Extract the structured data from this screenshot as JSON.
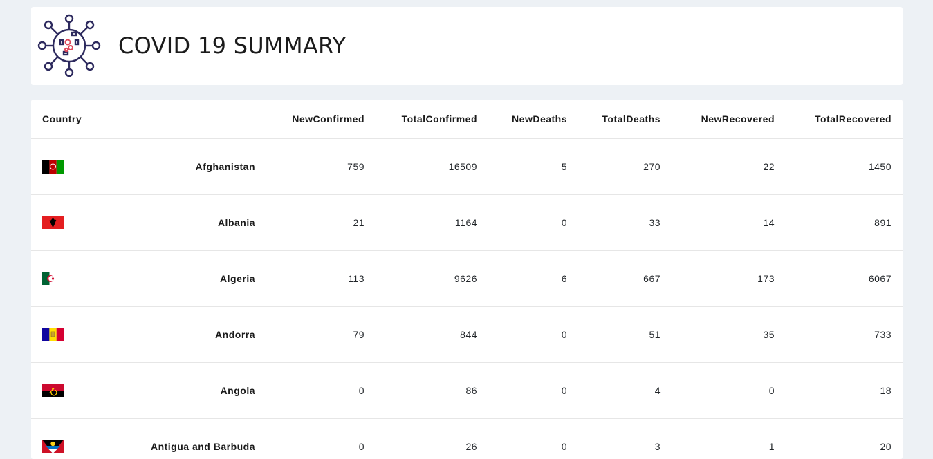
{
  "header": {
    "title": "COVID 19 SUMMARY",
    "logo_icon": "virus-icon",
    "logo_colors": {
      "outline": "#2d2a5e",
      "accent": "#e0485a"
    }
  },
  "table": {
    "columns": [
      "Country",
      "NewConfirmed",
      "TotalConfirmed",
      "NewDeaths",
      "TotalDeaths",
      "NewRecovered",
      "TotalRecovered"
    ],
    "rows": [
      {
        "flag": "afghanistan-flag-icon",
        "country": "Afghanistan",
        "NewConfirmed": "759",
        "TotalConfirmed": "16509",
        "NewDeaths": "5",
        "TotalDeaths": "270",
        "NewRecovered": "22",
        "TotalRecovered": "1450"
      },
      {
        "flag": "albania-flag-icon",
        "country": "Albania",
        "NewConfirmed": "21",
        "TotalConfirmed": "1164",
        "NewDeaths": "0",
        "TotalDeaths": "33",
        "NewRecovered": "14",
        "TotalRecovered": "891"
      },
      {
        "flag": "algeria-flag-icon",
        "country": "Algeria",
        "NewConfirmed": "113",
        "TotalConfirmed": "9626",
        "NewDeaths": "6",
        "TotalDeaths": "667",
        "NewRecovered": "173",
        "TotalRecovered": "6067"
      },
      {
        "flag": "andorra-flag-icon",
        "country": "Andorra",
        "NewConfirmed": "79",
        "TotalConfirmed": "844",
        "NewDeaths": "0",
        "TotalDeaths": "51",
        "NewRecovered": "35",
        "TotalRecovered": "733"
      },
      {
        "flag": "angola-flag-icon",
        "country": "Angola",
        "NewConfirmed": "0",
        "TotalConfirmed": "86",
        "NewDeaths": "0",
        "TotalDeaths": "4",
        "NewRecovered": "0",
        "TotalRecovered": "18"
      },
      {
        "flag": "antigua-and-barbuda-flag-icon",
        "country": "Antigua and Barbuda",
        "NewConfirmed": "0",
        "TotalConfirmed": "26",
        "NewDeaths": "0",
        "TotalDeaths": "3",
        "NewRecovered": "1",
        "TotalRecovered": "20"
      }
    ]
  }
}
